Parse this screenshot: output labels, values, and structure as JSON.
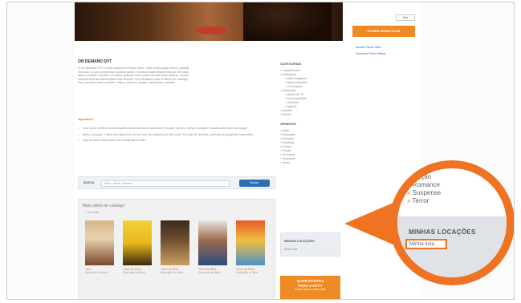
{
  "page": {
    "heading": "ON DEMAND DVT",
    "intro_lines": [
      "O On Demand DVT é uma locadora de filmes online. Você pode alugar filmes e assistir",
      "em casa, no seu computador, quando quiser. Os títulos ficam disponíveis por 48 horas",
      "após a locação e podem ser vistos quantas vezes quiser durante esse período. Novos",
      "lançamentos são adicionados toda semana, com destaque para os filmes do catálogo.",
      "Para começar basta escolher o filme, clicar em alugar e aproveitar a sessão."
    ],
    "notice_label": "Importante:",
    "bullets": [
      "Você pode conferir as informações completas sobre cada filme (sinopse, gênero, elenco, duração, classificação) antes de alugar.",
      "Após a locação, o filme fica disponível na sua área de locações por 48 horas. Em caso de dúvidas, consulte as perguntas frequentes.",
      "Veja os filmes disponíveis nas categorias ao lado."
    ],
    "search": {
      "label": "BUSCA",
      "placeholder": "filmes, atores, diretores",
      "button": "Buscar"
    },
    "catalog": {
      "title": "Mais vistos do catálogo",
      "subtitle": "» Ver todos",
      "movies": [
        {
          "title": "Juno",
          "desc": "Descrição do filme"
        },
        {
          "title": "Título do filme",
          "desc": "Descrição do filme"
        },
        {
          "title": "Título do filme",
          "desc": "Descrição do filme"
        },
        {
          "title": "Título do filme",
          "desc": "Descrição do filme"
        },
        {
          "title": "Título do filme",
          "desc": "Descrição do filme"
        }
      ]
    },
    "sidebar": {
      "categories_heading": "CATEGORIAS",
      "categories": [
        {
          "label": "Lançamentos",
          "sub": false
        },
        {
          "label": "Destaques",
          "sub": false
        },
        {
          "label": "Mais Alugados",
          "sub": true
        },
        {
          "label": "Mais Assistidos",
          "sub": true
        },
        {
          "label": "Promoções",
          "sub": true
        },
        {
          "label": "Novidades",
          "sub": false
        },
        {
          "label": "Séries de TV",
          "sub": true
        },
        {
          "label": "Documentários",
          "sub": true
        },
        {
          "label": "Musicais",
          "sub": true
        },
        {
          "label": "Infantis",
          "sub": true
        },
        {
          "label": "Adultos",
          "sub": false
        },
        {
          "label": "Shows",
          "sub": false
        }
      ],
      "genres_heading": "GÊNEROS",
      "genres": [
        "Ação",
        "Animação",
        "Aventura",
        "Comédia",
        "Drama",
        "Ficção",
        "Romance",
        "Suspense",
        "Terror"
      ],
      "mini_rentals_heading": "MINHAS LOCAÇÕES",
      "mini_rentals_item": "Minha lista",
      "cta_line1": "QUER PONTOS",
      "cta_line2": "PARA A DVT?",
      "cta_small": "Acesse agora e saiba mais"
    },
    "right": {
      "sair": "Sair",
      "club_label": "FILMES MAXIS CLUB",
      "club_links": [
        "Assistir Filmes Mais",
        "Descubra Filmes Maxis"
      ]
    },
    "zoom": {
      "genres": [
        "Ficção",
        "Romance",
        "Suspense",
        "Terror"
      ],
      "rentals_heading": "MINHAS LOCAÇÕES",
      "highlighted_item": "Minha lista"
    },
    "colors": {
      "accent": "#ef7322",
      "link": "#2d6fb4"
    }
  }
}
